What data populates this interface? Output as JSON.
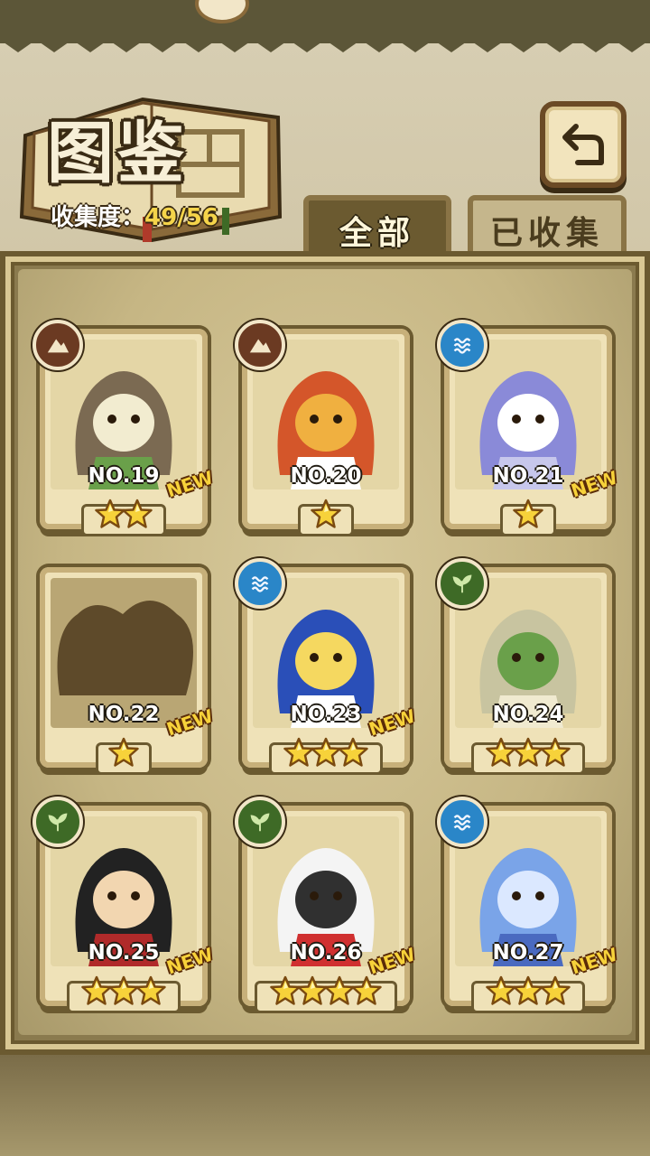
{
  "header": {
    "title": "图鉴",
    "collection_label": "收集度：",
    "collection_value": "49/56"
  },
  "tabs": [
    {
      "label": "全部",
      "active": true
    },
    {
      "label": "已收集",
      "active": false
    }
  ],
  "cards": [
    {
      "number": "NO.19",
      "stars": 2,
      "element": "earth",
      "is_new": true,
      "locked": false,
      "portrait_colors": [
        "#7b6a52",
        "#f2ecd0",
        "#6aa04a"
      ]
    },
    {
      "number": "NO.20",
      "stars": 1,
      "element": "earth",
      "is_new": false,
      "locked": false,
      "portrait_colors": [
        "#d4562a",
        "#f0b040",
        "#ffffff"
      ]
    },
    {
      "number": "NO.21",
      "stars": 1,
      "element": "water",
      "is_new": true,
      "locked": false,
      "portrait_colors": [
        "#8a8ad8",
        "#ffffff",
        "#c7c7ec"
      ]
    },
    {
      "number": "NO.22",
      "stars": 1,
      "element": "",
      "is_new": true,
      "locked": true,
      "portrait_colors": [
        "#5e4a2a",
        "#5e4a2a",
        "#5e4a2a"
      ]
    },
    {
      "number": "NO.23",
      "stars": 3,
      "element": "water",
      "is_new": true,
      "locked": false,
      "portrait_colors": [
        "#2a4fb8",
        "#f5d860",
        "#ffffff"
      ]
    },
    {
      "number": "NO.24",
      "stars": 3,
      "element": "wood",
      "is_new": false,
      "locked": false,
      "portrait_colors": [
        "#c8c4a0",
        "#6aa04a",
        "#f0ead0"
      ]
    },
    {
      "number": "NO.25",
      "stars": 3,
      "element": "wood",
      "is_new": true,
      "locked": false,
      "portrait_colors": [
        "#222222",
        "#f2d6b0",
        "#b02a2a"
      ]
    },
    {
      "number": "NO.26",
      "stars": 4,
      "element": "wood",
      "is_new": true,
      "locked": false,
      "portrait_colors": [
        "#f4f4f4",
        "#303030",
        "#d03030"
      ]
    },
    {
      "number": "NO.27",
      "stars": 3,
      "element": "water",
      "is_new": true,
      "locked": false,
      "portrait_colors": [
        "#7aa4e8",
        "#dbe8ff",
        "#4a6ac0"
      ]
    }
  ],
  "new_label": "NEW",
  "colors": {
    "accent_gold": "#f5d44a",
    "frame_brown": "#6b5a30"
  }
}
